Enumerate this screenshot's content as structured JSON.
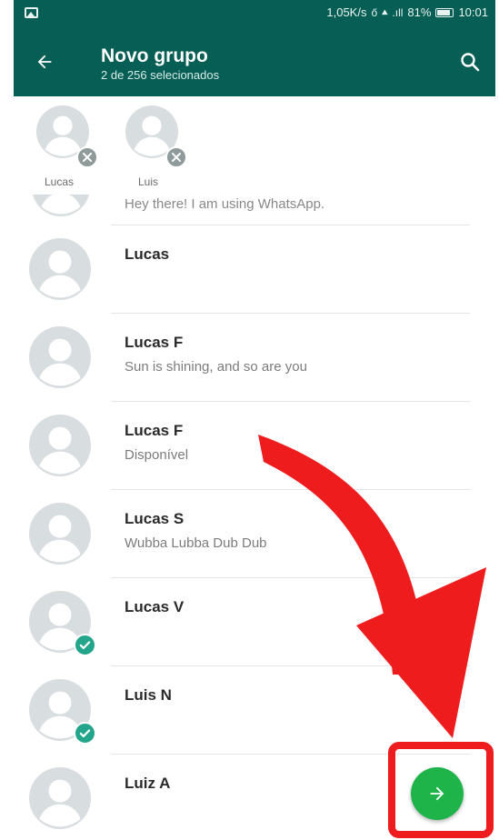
{
  "status_bar": {
    "network_speed": "1,05K/s",
    "signal_text": "ő ⯅ .ıll",
    "battery": "81%",
    "time": "10:01"
  },
  "app_bar": {
    "title": "Novo grupo",
    "subtitle": "2 de 256 selecionados"
  },
  "selected_contacts": [
    {
      "name": "Lucas"
    },
    {
      "name": "Luis"
    }
  ],
  "contacts": [
    {
      "name": "",
      "status": "Hey there! I am using WhatsApp.",
      "selected": false,
      "partial": true
    },
    {
      "name": "Lucas",
      "status": "",
      "selected": false
    },
    {
      "name": "Lucas F",
      "status": "Sun is shining, and so are you",
      "selected": false
    },
    {
      "name": "Lucas F",
      "status": "Disponível",
      "selected": false
    },
    {
      "name": "Lucas S",
      "status": "Wubba Lubba Dub Dub",
      "selected": false
    },
    {
      "name": "Lucas V",
      "status": "",
      "selected": true
    },
    {
      "name": "Luis N",
      "status": "",
      "selected": true
    },
    {
      "name": "Luiz A",
      "status": "",
      "selected": false
    }
  ],
  "colors": {
    "header": "#075e54",
    "check": "#22a58a",
    "fab": "#1fb44a",
    "annotation": "#ee1c1c"
  }
}
